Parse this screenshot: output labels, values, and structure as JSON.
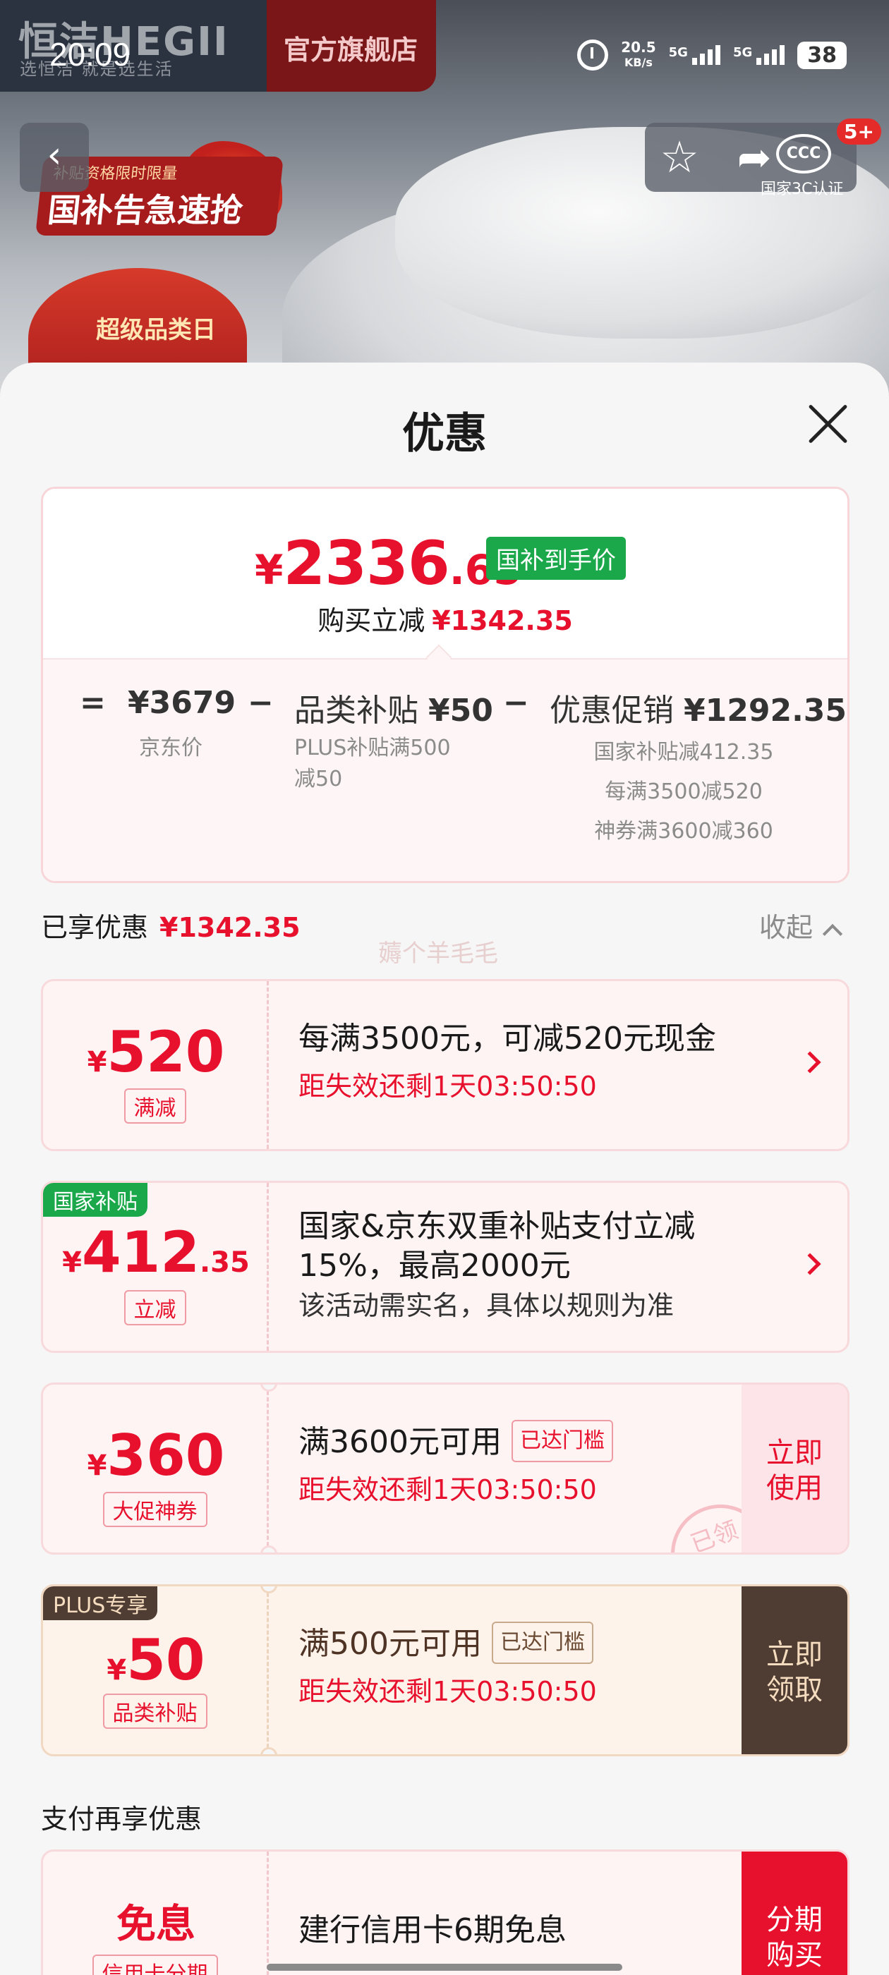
{
  "status_bar": {
    "time": "20:09",
    "speed_value": "20.5",
    "speed_unit": "KB/s",
    "net1": "5G",
    "net2": "5G",
    "battery": "38"
  },
  "background": {
    "brand": "恒洁HEGII",
    "slogan": "选恒洁 就是选生活",
    "store": "官方旗舰店",
    "promo_small": "补贴资格限时限量",
    "promo_big": "国补告急速抢",
    "jd_badge": "超级品类日",
    "cert_logo": "CCC",
    "cert_text": "国家3C认证",
    "cart_badge": "5+"
  },
  "sheet": {
    "title": "优惠",
    "summary": {
      "currency": "¥",
      "price_int": "2336",
      "price_dec": ".65",
      "price_tag": "国补到手价",
      "reduce_label": "购买立减",
      "reduce_value": "¥1342.35",
      "equals": "=",
      "minus": "−",
      "jd_price": "¥3679",
      "jd_price_label": "京东价",
      "category_label": "品类补贴",
      "category_value": "¥50",
      "category_sub_1": "PLUS补贴满500",
      "category_sub_2": "减50",
      "promo_label": "优惠促销",
      "promo_value": "¥1292.35",
      "promo_sub_1": "国家补贴减412.35",
      "promo_sub_2": "每满3500减520",
      "promo_sub_3": "神券满3600减360"
    },
    "enjoyed_label": "已享优惠",
    "enjoyed_value": "¥1342.35",
    "collapse_label": "收起",
    "watermark": "薅个羊毛毛",
    "coupons": [
      {
        "currency": "¥",
        "amount": "520",
        "type": "满减",
        "line1": "每满3500元，可减520元现金",
        "countdown": "距失效还剩1天03:50:50"
      },
      {
        "corner_tag": "国家补贴",
        "currency": "¥",
        "amount": "412",
        "amount_dec": ".35",
        "type": "立减",
        "line1": "国家&京东双重补贴支付立减",
        "line2": "15%，最高2000元",
        "line3": "该活动需实名，具体以规则为准"
      },
      {
        "currency": "¥",
        "amount": "360",
        "type": "大促神券",
        "line1": "满3600元可用",
        "reached": "已达门槛",
        "countdown": "距失效还剩1天03:50:50",
        "action_1": "立即",
        "action_2": "使用",
        "stamp": "已领"
      },
      {
        "corner_tag": "PLUS专享",
        "currency": "¥",
        "amount": "50",
        "type": "品类补贴",
        "line1": "满500元可用",
        "reached": "已达门槛",
        "countdown": "距失效还剩1天03:50:50",
        "action_1": "立即",
        "action_2": "领取"
      }
    ],
    "pay_section_label": "支付再享优惠",
    "pay_coupon": {
      "title": "免息",
      "type": "信用卡分期",
      "line1": "建行信用卡6期免息",
      "action_1": "分期",
      "action_2": "购买"
    }
  }
}
